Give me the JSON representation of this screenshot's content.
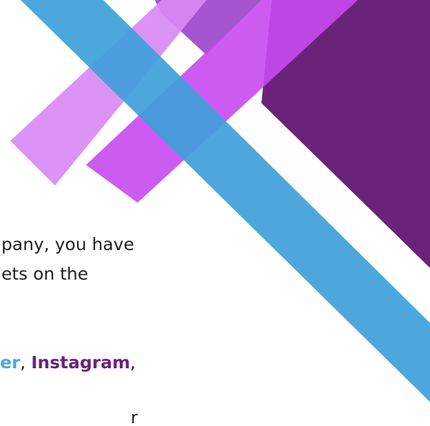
{
  "text": {
    "line1": "pany, you have",
    "line2": "ets on the",
    "line3": {
      "brand_a": "er",
      "sep1": ", ",
      "brand_b": "Instagram",
      "sep2": ","
    },
    "line4": "r"
  },
  "colors": {
    "purple_dark": "#6b237a",
    "purple_mid": "#a04ccf",
    "violet_light": "#d68af5",
    "magenta": "#cc44ee",
    "blue": "#4aa8dc",
    "brand_a": "#4aa8dc",
    "brand_b": "#6b237a"
  }
}
